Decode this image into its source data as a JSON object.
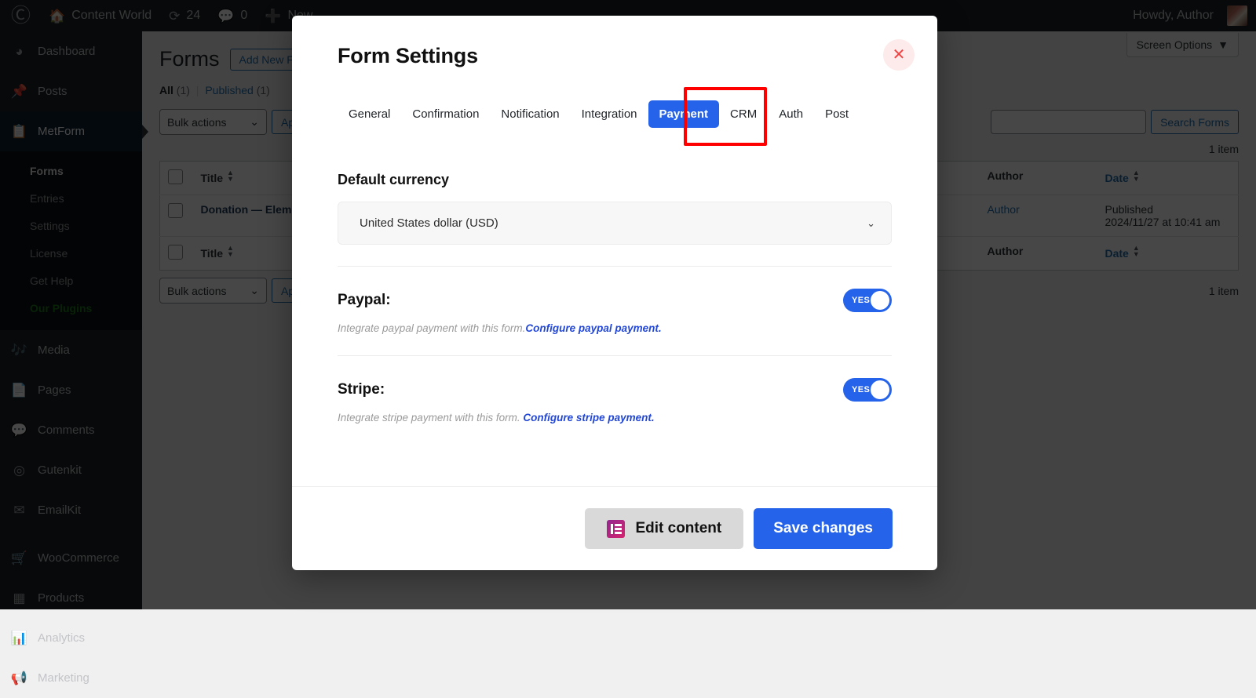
{
  "adminbar": {
    "logo_icon": "wordpress-logo-icon",
    "site_icon": "home-icon",
    "site_name": "Content World",
    "updates_icon": "updates-icon",
    "updates_count": "24",
    "comments_icon": "comment-bubble-icon",
    "comments_count": "0",
    "new_icon": "plus-icon",
    "new_label": "New",
    "howdy": "Howdy, Author"
  },
  "sidebar": {
    "items": [
      {
        "label": "Dashboard",
        "icon": "dashboard-icon"
      },
      {
        "label": "Posts",
        "icon": "pin-icon"
      },
      {
        "label": "MetForm",
        "icon": "metform-icon",
        "current": true
      },
      {
        "label": "Media",
        "icon": "media-icon"
      },
      {
        "label": "Pages",
        "icon": "pages-icon"
      },
      {
        "label": "Comments",
        "icon": "comment-bubble-icon"
      },
      {
        "label": "Gutenkit",
        "icon": "gutenkit-icon"
      },
      {
        "label": "EmailKit",
        "icon": "envelope-icon"
      },
      {
        "label": "WooCommerce",
        "icon": "woocommerce-icon"
      },
      {
        "label": "Products",
        "icon": "products-icon"
      },
      {
        "label": "Analytics",
        "icon": "analytics-icon"
      },
      {
        "label": "Marketing",
        "icon": "megaphone-icon"
      }
    ],
    "submenu": [
      {
        "label": "Forms",
        "current": true
      },
      {
        "label": "Entries"
      },
      {
        "label": "Settings"
      },
      {
        "label": "License"
      },
      {
        "label": "Get Help"
      },
      {
        "label": "Our Plugins",
        "highlight": true
      }
    ]
  },
  "screen_options": {
    "label": "Screen Options",
    "icon": "chevron-down-icon"
  },
  "forms_page": {
    "title": "Forms",
    "add_new_label": "Add New Form",
    "filters": {
      "all_label": "All",
      "all_count": "(1)",
      "separator": "|",
      "published_label": "Published",
      "published_count": "(1)"
    },
    "bulk_actions_label": "Bulk actions",
    "apply_label": "Apply",
    "search_placeholder": "",
    "search_value": "",
    "search_button": "Search Forms",
    "item_count": "1 item",
    "columns": {
      "title": "Title",
      "author": "Author",
      "date": "Date"
    },
    "rows": [
      {
        "title": "Donation — Elementor",
        "author": "Author",
        "date_status": "Published",
        "date_value": "2024/11/27 at 10:41 am"
      }
    ]
  },
  "modal": {
    "title": "Form Settings",
    "close_icon": "close-icon",
    "tabs": [
      {
        "label": "General"
      },
      {
        "label": "Confirmation"
      },
      {
        "label": "Notification"
      },
      {
        "label": "Integration"
      },
      {
        "label": "Payment",
        "active": true,
        "highlighted": true
      },
      {
        "label": "CRM"
      },
      {
        "label": "Auth"
      },
      {
        "label": "Post"
      }
    ],
    "currency": {
      "label": "Default currency",
      "selected": "United States dollar (USD)",
      "chevron_icon": "chevron-down-icon"
    },
    "payments": [
      {
        "label": "Paypal:",
        "toggle_state": "YES",
        "help_text": "Integrate paypal payment with this form.",
        "help_link": "Configure paypal payment."
      },
      {
        "label": "Stripe:",
        "toggle_state": "YES",
        "help_text": "Integrate stripe payment with this form. ",
        "help_link": "Configure stripe payment."
      }
    ],
    "footer": {
      "edit_content_label": "Edit content",
      "edit_content_icon": "elementor-icon",
      "save_changes_label": "Save changes"
    }
  },
  "colors": {
    "accent_blue": "#2563eb",
    "highlight_red": "#ff0000",
    "link_blue": "#2247d6",
    "admin_dark": "#1d2327"
  }
}
